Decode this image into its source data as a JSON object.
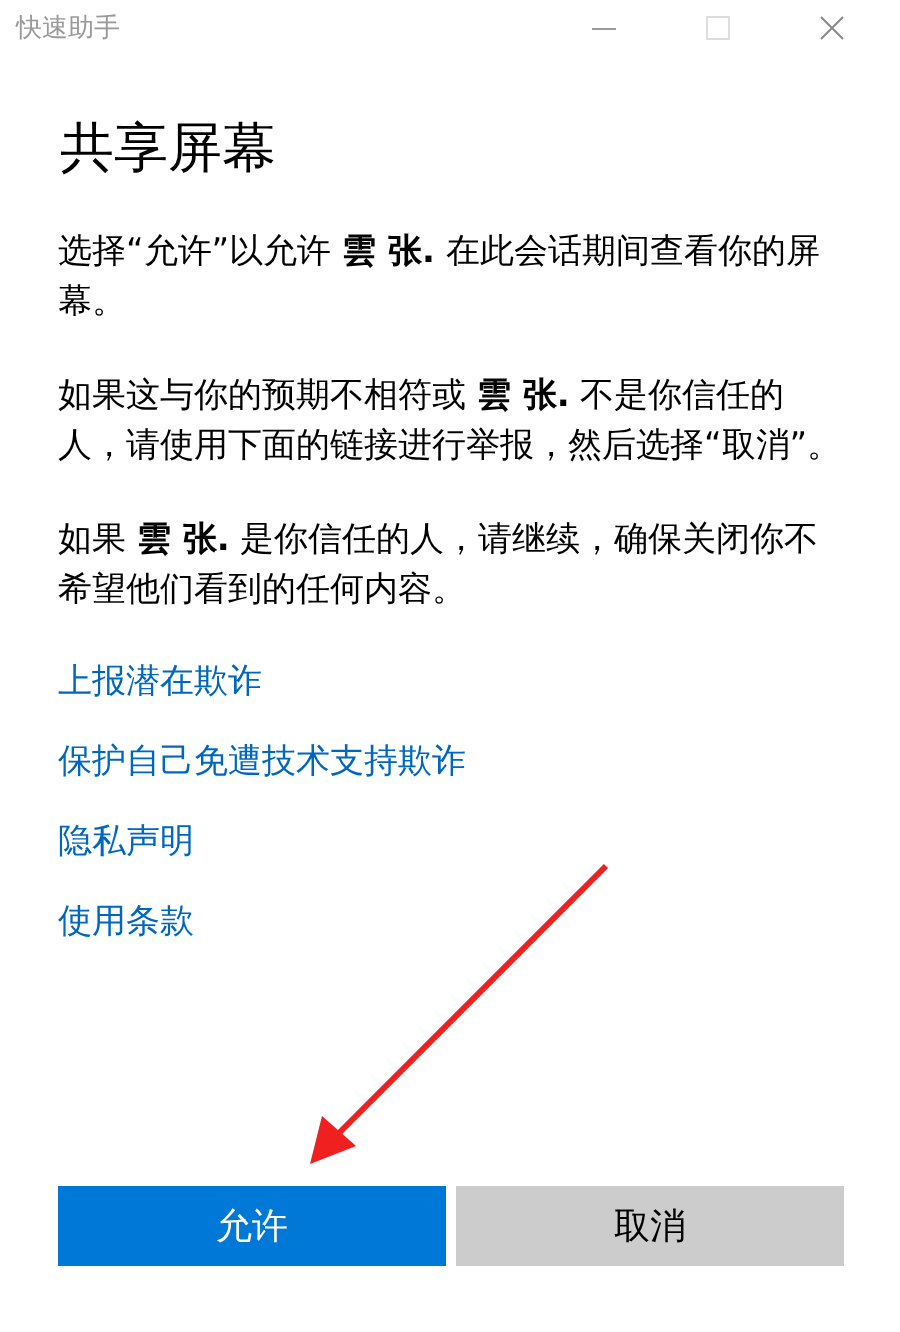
{
  "window": {
    "title": "快速助手"
  },
  "heading": "共享屏幕",
  "paragraphs": [
    "选择“允许”以允许 **雲 张.** 在此会话期间查看你的屏幕。",
    "如果这与你的预期不相符或 **雲 张.** 不是你信任的人，请使用下面的链接进行举报，然后选择“取消”。",
    "如果 **雲 张.** 是你信任的人，请继续，确保关闭你不希望他们看到的任何内容。"
  ],
  "links": [
    "上报潜在欺诈",
    "保护自己免遭技术支持欺诈",
    "隐私声明",
    "使用条款"
  ],
  "buttons": [
    {
      "label": "允许",
      "kind": "primary"
    },
    {
      "label": "取消",
      "kind": "secondary"
    }
  ]
}
